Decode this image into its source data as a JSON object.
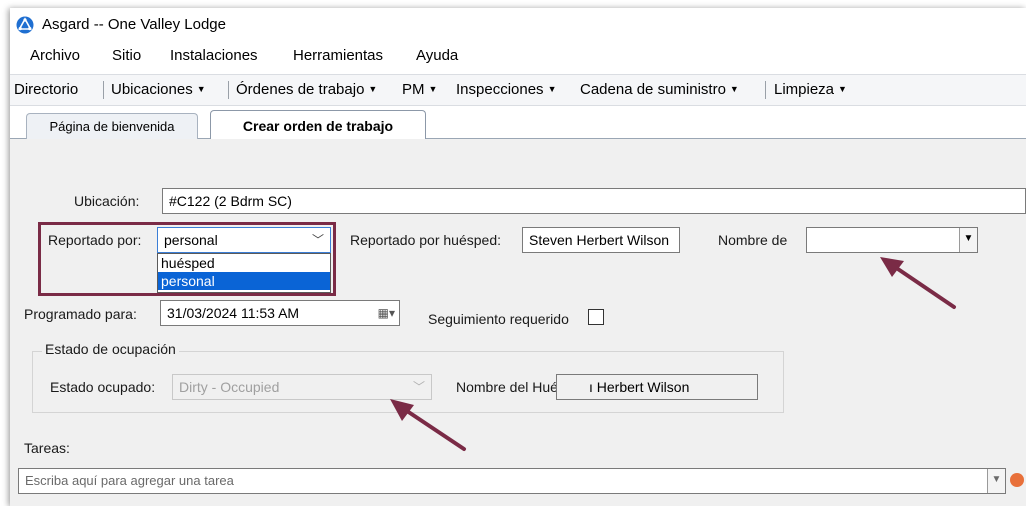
{
  "window": {
    "title": "Asgard -- One Valley Lodge"
  },
  "menu": [
    "Archivo",
    "Sitio",
    "Instalaciones",
    "Herramientas",
    "Ayuda"
  ],
  "nav": {
    "directory": "Directorio",
    "locations": "Ubicaciones",
    "work_orders": "Órdenes de trabajo",
    "pm": "PM",
    "inspections": "Inspecciones",
    "supply_chain": "Cadena de suministro",
    "cleaning": "Limpieza"
  },
  "tabs": {
    "welcome": "Página de bienvenida",
    "create_work_order": "Crear orden de trabajo"
  },
  "form": {
    "location_label": "Ubicación:",
    "location_value": "#C122 (2 Bdrm SC)",
    "reported_by_label": "Reportado por:",
    "reported_by_value": "personal",
    "reported_by_options": [
      "huésped",
      "personal"
    ],
    "reported_by_guest_label": "Reportado por huésped:",
    "reported_by_guest_value": "Steven Herbert Wilson",
    "name_of_label": "Nombre de",
    "name_of_value": "",
    "scheduled_label": "Programado para:",
    "scheduled_value": "31/03/2024 11:53 AM",
    "follow_up_label": "Seguimiento requerido",
    "occupancy_group_label": "Estado de ocupación",
    "occupied_state_label": "Estado ocupado:",
    "occupied_state_value": "Dirty - Occupied",
    "guest_name_label": "Nombre del Huésped:",
    "guest_name_value": "ı Herbert Wilson",
    "tasks_label": "Tareas:",
    "tasks_placeholder": "Escriba aquí para agregar una tarea"
  },
  "colors": {
    "highlight_box": "#7a2b46",
    "selection": "#0a64d6",
    "arrow": "#7a2b46"
  }
}
